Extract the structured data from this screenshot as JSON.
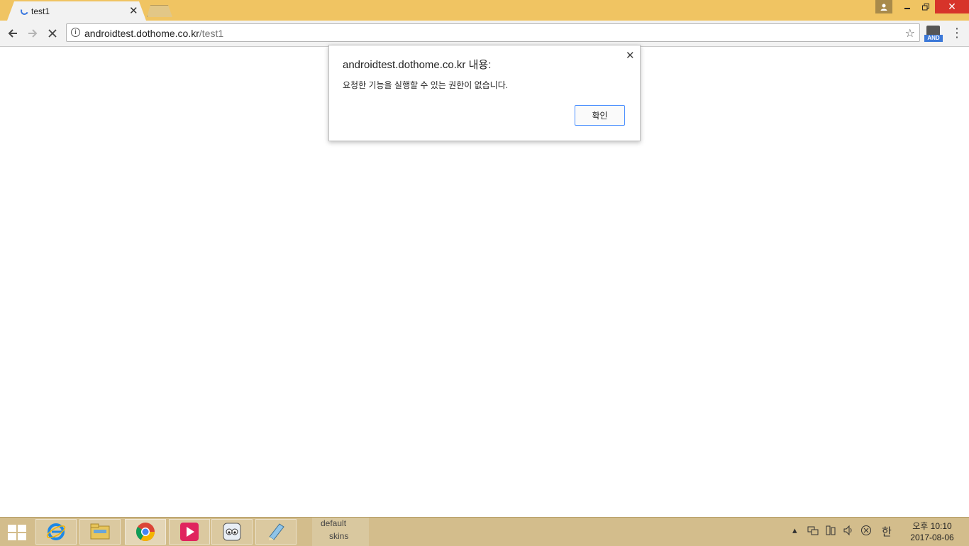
{
  "browser": {
    "tab": {
      "title": "test1"
    },
    "address": {
      "host": "androidtest.dothome.co.kr",
      "path": "/test1"
    },
    "extension": {
      "badge": "AND"
    }
  },
  "dialog": {
    "title": "androidtest.dothome.co.kr 내용:",
    "message": "요청한 기능을 실행할 수 있는 권한이 없습니다.",
    "ok_label": "확인"
  },
  "taskbar": {
    "folder_items": [
      "default",
      "skins"
    ],
    "ime": "한",
    "clock": {
      "time": "오후 10:10",
      "date": "2017-08-06"
    }
  },
  "colors": {
    "title_bar": "#f0c462",
    "close_button": "#d7342a",
    "dialog_button_border": "#4d90fe",
    "taskbar": "#d3bd8c"
  }
}
